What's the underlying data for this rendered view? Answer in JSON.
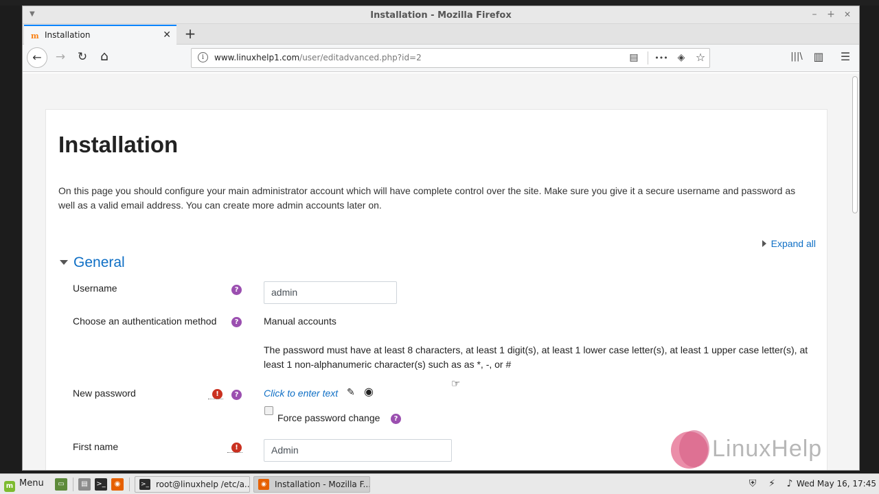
{
  "window": {
    "title": "Installation - Mozilla Firefox",
    "minimize": "–",
    "maximize": "+",
    "close": "✕"
  },
  "tab": {
    "title": "Installation",
    "favicon": "m",
    "close": "✕",
    "new_tab": "+"
  },
  "nav": {
    "back": "←",
    "forward": "→",
    "reload": "↻",
    "home": "⌂"
  },
  "urlbar": {
    "host": "www.linuxhelp1.com",
    "path": "/user/editadvanced.php?id=2",
    "info": "i",
    "reader": "▤",
    "more": "•••",
    "pocket": "◈",
    "bookmark": "☆"
  },
  "toolbar": {
    "library": "|||\\",
    "sidebar": "▥",
    "menu": "☰"
  },
  "page": {
    "title": "Installation",
    "intro": "On this page you should configure your main administrator account which will have complete control over the site. Make sure you give it a secure username and password as well as a valid email address. You can create more admin accounts later on.",
    "expand_all": "Expand all",
    "section": "General",
    "fields": {
      "username_label": "Username",
      "username_value": "admin",
      "auth_label": "Choose an authentication method",
      "auth_value": "Manual accounts",
      "password_policy": "The password must have at least 8 characters, at least 1 digit(s), at least 1 lower case letter(s), at least 1 upper case letter(s), at least 1 non-alphanumeric character(s) such as as *, -, or #",
      "password_label": "New password",
      "password_placeholder": "Click to enter text",
      "force_change_label": "Force password change",
      "firstname_label": "First name",
      "firstname_value": "Admin"
    },
    "help_glyph": "?",
    "required_glyph": "!"
  },
  "watermark": {
    "text": "LinuxHelp"
  },
  "taskbar": {
    "menu": "Menu",
    "tasks": [
      {
        "label": "root@linuxhelp /etc/a..."
      },
      {
        "label": "Installation - Mozilla F..."
      }
    ],
    "clock": "Wed May 16, 17:45"
  },
  "colors": {
    "accent": "#0f6fc5",
    "help": "#9b4fb0",
    "required": "#ca3120",
    "tab_highlight": "#0a84ff"
  }
}
